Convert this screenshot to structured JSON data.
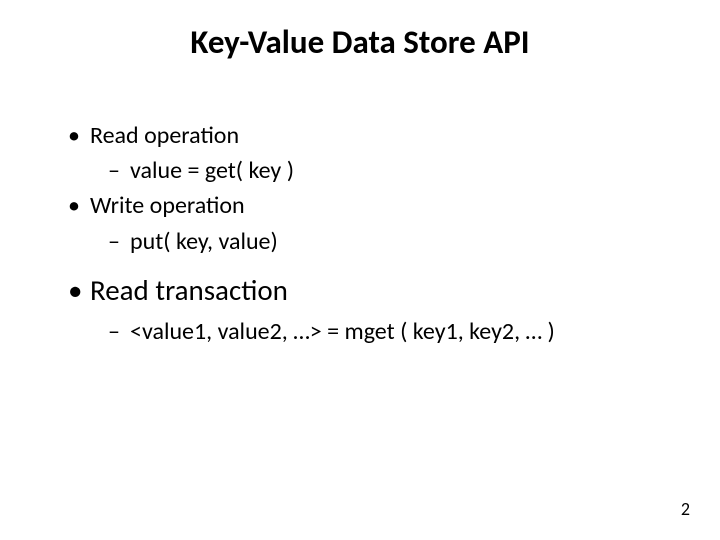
{
  "title": "Key-Value Data Store API",
  "bullets": {
    "b1": "Read operation",
    "b1a": "value = get( key )",
    "b2": "Write operation",
    "b2a": "put( key, value)",
    "b3": "Read transaction",
    "b3a": "<value1, value2, …> = mget ( key1, key2, … )"
  },
  "page_number": "2"
}
